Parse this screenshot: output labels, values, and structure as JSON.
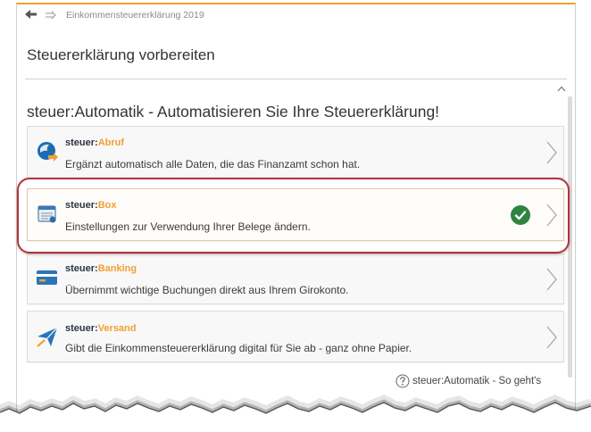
{
  "nav": {
    "back_icon": "arrow-left-icon",
    "forward_icon": "arrow-right-icon",
    "breadcrumb": "Einkommensteuererklärung 2019"
  },
  "page_title": "Steuererklärung vorbereiten",
  "section": {
    "heading": "steuer:Automatik - Automatisieren Sie Ihre Steuererklärung!",
    "cards": [
      {
        "brand": "steuer:",
        "name": "Abruf",
        "description": "Ergänzt automatisch alle Daten, die das Finanzamt schon hat.",
        "icon": "abruf-globe-icon",
        "action_icon": "chevron-right-icon"
      },
      {
        "brand": "steuer:",
        "name": "Box",
        "description": "Einstellungen zur Verwendung Ihrer Belege ändern.",
        "icon": "box-icon",
        "status_icon": "check-circle-icon",
        "action_icon": "chevron-right-icon"
      },
      {
        "brand": "steuer:",
        "name": "Banking",
        "description": "Übernimmt wichtige Buchungen direkt aus Ihrem Girokonto.",
        "icon": "bank-card-icon",
        "action_icon": "chevron-right-icon"
      },
      {
        "brand": "steuer:",
        "name": "Versand",
        "description": "Gibt die Einkommensteuererklärung digital für Sie ab - ganz ohne Papier.",
        "icon": "paper-plane-icon",
        "action_icon": "chevron-right-icon"
      }
    ]
  },
  "help_link": {
    "icon": "help-circle-icon",
    "label": "steuer:Automatik - So geht's"
  },
  "colors": {
    "accent": "#f0a030",
    "brand": "#2b3440",
    "success": "#2e8540",
    "highlight": "#b5343a",
    "iconblue": "#2a74bb"
  }
}
